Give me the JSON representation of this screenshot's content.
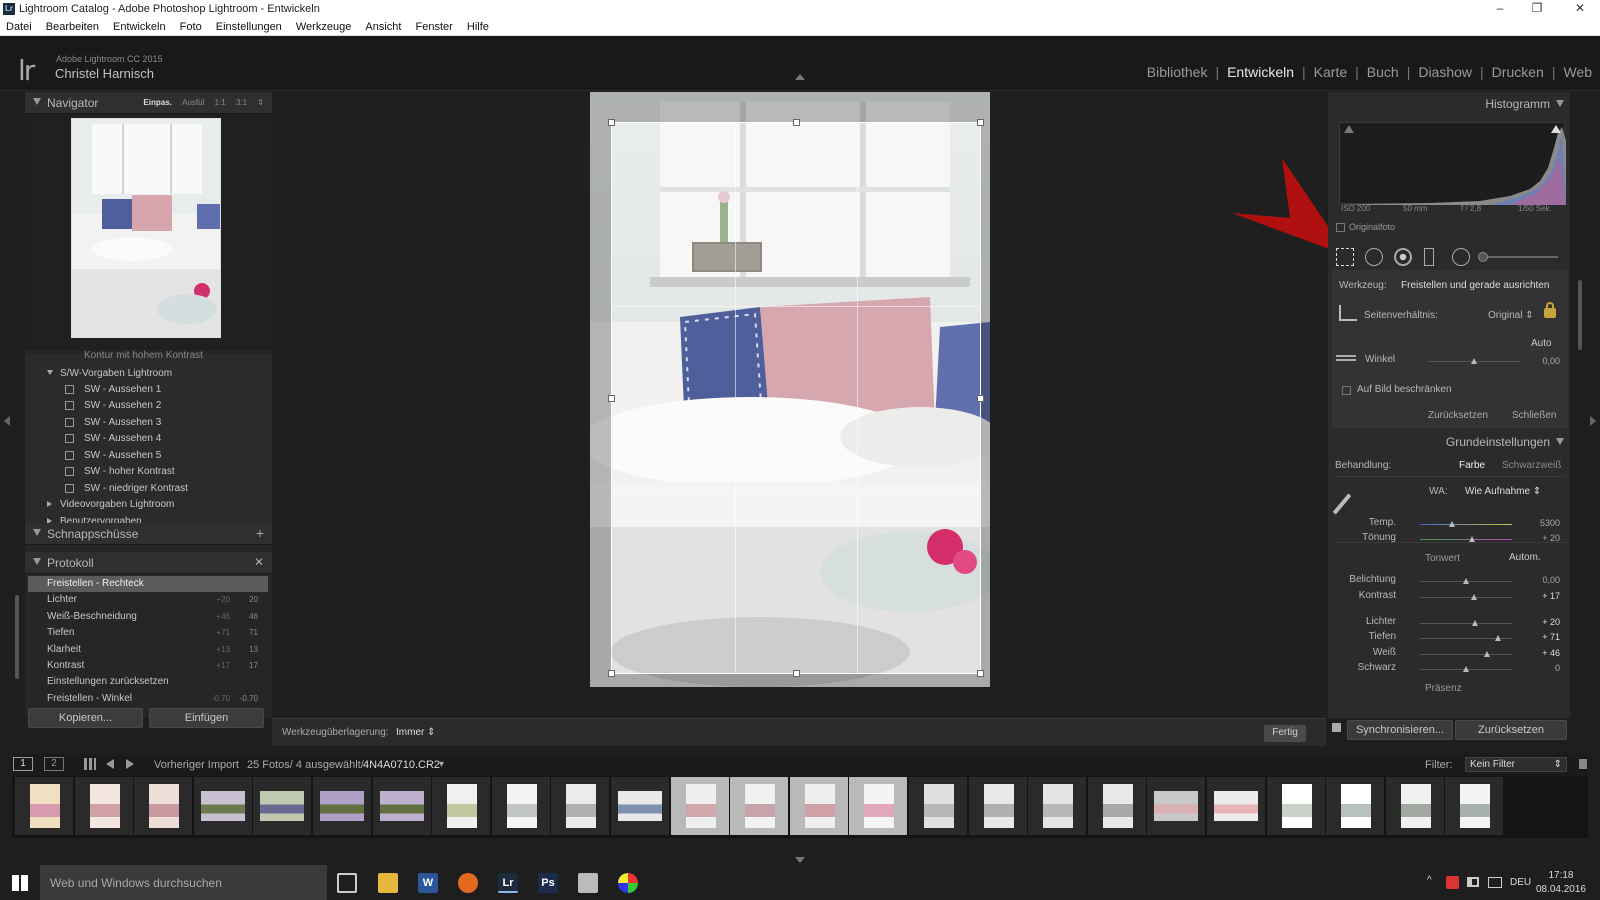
{
  "window": {
    "title": "Lightroom Catalog - Adobe Photoshop Lightroom - Entwickeln",
    "app_icon": "Lr",
    "minimize": "–",
    "maximize": "❐",
    "close": "✕"
  },
  "menu": [
    "Datei",
    "Bearbeiten",
    "Entwickeln",
    "Foto",
    "Einstellungen",
    "Werkzeuge",
    "Ansicht",
    "Fenster",
    "Hilfe"
  ],
  "identity": {
    "logo": "lr",
    "product": "Adobe Lightroom CC 2015",
    "user": "Christel Harnisch"
  },
  "modules": {
    "items": [
      "Bibliothek",
      "Entwickeln",
      "Karte",
      "Buch",
      "Diashow",
      "Drucken",
      "Web"
    ],
    "active": "Entwickeln",
    "separator": "|"
  },
  "navigator": {
    "title": "Navigator",
    "zoom": [
      "Einpas.",
      "Ausfül",
      "1:1",
      "3:1"
    ],
    "zoom_active": "Einpas.",
    "zoom_more": "⇕"
  },
  "presets": {
    "partial_row": "Kontur mit hohem Kontrast",
    "folder_open": "S/W-Vorgaben Lightroom",
    "items": [
      "SW - Aussehen 1",
      "SW - Aussehen 2",
      "SW - Aussehen 3",
      "SW - Aussehen 4",
      "SW - Aussehen 5",
      "SW - hoher Kontrast",
      "SW - niedriger Kontrast"
    ],
    "folders_closed": [
      "Videovorgaben Lightroom",
      "Benutzervorgaben"
    ]
  },
  "snapshots": {
    "title": "Schnappschüsse",
    "add": "+"
  },
  "history": {
    "title": "Protokoll",
    "clear": "✕",
    "items": [
      {
        "label": "Freistellen - Rechteck",
        "a": "",
        "b": ""
      },
      {
        "label": "Lichter",
        "a": "+20",
        "b": "20"
      },
      {
        "label": "Weiß-Beschneidung",
        "a": "+46",
        "b": "46"
      },
      {
        "label": "Tiefen",
        "a": "+71",
        "b": "71"
      },
      {
        "label": "Klarheit",
        "a": "+13",
        "b": "13"
      },
      {
        "label": "Kontrast",
        "a": "+17",
        "b": "17"
      },
      {
        "label": "Einstellungen zurücksetzen",
        "a": "",
        "b": ""
      },
      {
        "label": "Freistellen - Winkel",
        "a": "-0.70",
        "b": "-0.70"
      }
    ]
  },
  "left_buttons": {
    "copy": "Kopieren...",
    "paste": "Einfügen"
  },
  "toolbar": {
    "overlay_label": "Werkzeugüberlagerung:",
    "overlay_value": "Immer",
    "overlay_arrows": "⇕",
    "done": "Fertig"
  },
  "histogram": {
    "title": "Histogramm",
    "iso": "ISO 200",
    "focal": "50 mm",
    "aperture": "f / 2,8",
    "shutter": "1/50 Sek.",
    "original_label": "Originalfoto"
  },
  "crop": {
    "tool_label": "Werkzeug:",
    "tool_value": "Freistellen und gerade ausrichten",
    "ratio_label": "Seitenverhältnis:",
    "ratio_value": "Original",
    "ratio_arrows": "⇕",
    "auto": "Auto",
    "angle_label": "Winkel",
    "angle_value": "0,00",
    "angle_pos": 0.5,
    "constrain_label": "Auf Bild beschränken",
    "reset": "Zurücksetzen",
    "close": "Schließen"
  },
  "basic": {
    "title": "Grundeinstellungen",
    "treatment_label": "Behandlung:",
    "treatment_color": "Farbe",
    "treatment_bw": "Schwarzweiß",
    "wb_label": "WA:",
    "wb_value": "Wie Aufnahme",
    "wb_arrows": "⇕",
    "tone_label": "Tonwert",
    "auto_tone": "Autom.",
    "presence": "Präsenz",
    "sliders": [
      {
        "label": "Temp.",
        "value": "5300",
        "pos": 0.35,
        "kind": "temp"
      },
      {
        "label": "Tönung",
        "value": "+ 20",
        "pos": 0.57,
        "kind": "tint"
      },
      {
        "label": "Belichtung",
        "value": "0,00",
        "pos": 0.5,
        "kind": "plain"
      },
      {
        "label": "Kontrast",
        "value": "+ 17",
        "pos": 0.59,
        "kind": "plain"
      },
      {
        "label": "Lichter",
        "value": "+ 20",
        "pos": 0.6,
        "kind": "plain"
      },
      {
        "label": "Tiefen",
        "value": "+ 71",
        "pos": 0.85,
        "kind": "plain"
      },
      {
        "label": "Weiß",
        "value": "+ 46",
        "pos": 0.73,
        "kind": "plain"
      },
      {
        "label": "Schwarz",
        "value": "0",
        "pos": 0.5,
        "kind": "plain"
      }
    ]
  },
  "right_buttons": {
    "sync": "Synchronisieren...",
    "reset": "Zurücksetzen"
  },
  "filmbar": {
    "page1": "1",
    "page2": "2",
    "source": "Vorheriger Import",
    "count": "25 Fotos/ 4 ausgewählt/",
    "filename": "4N4A0710.CR2",
    "filename_arrow": "▾",
    "filter_label": "Filter:",
    "filter_value": "Kein Filter",
    "filter_arrows": "⇕"
  },
  "filmstrip_selected": [
    11,
    12,
    13,
    14
  ],
  "taskbar": {
    "search": "Web und Windows durchsuchen",
    "icons": [
      {
        "name": "word",
        "label": "W",
        "color": "#2b579a"
      },
      {
        "name": "lightroom",
        "label": "Lr",
        "color": "#1b2b3c"
      },
      {
        "name": "photoshop",
        "label": "Ps",
        "color": "#1b2b4c"
      }
    ],
    "lang": "DEU",
    "time": "17:18",
    "date": "08.04.2016"
  },
  "colors": {
    "arrow": "#b01010",
    "accent": "#e8e8e8"
  }
}
